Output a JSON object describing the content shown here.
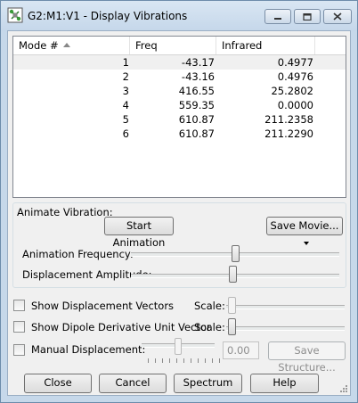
{
  "window": {
    "title": "G2:M1:V1 - Display Vibrations",
    "app_icon": "gaussview-app-icon",
    "controls": [
      "minimize-icon",
      "maximize-icon",
      "close-icon"
    ]
  },
  "table": {
    "columns": [
      "Mode #",
      "Freq",
      "Infrared"
    ],
    "sort_column": "Mode #",
    "sort_direction": "ascending",
    "selected_row": 0,
    "rows": [
      {
        "mode": "1",
        "freq": "-43.17",
        "ir": "0.4977"
      },
      {
        "mode": "2",
        "freq": "-43.16",
        "ir": "0.4976"
      },
      {
        "mode": "3",
        "freq": "416.55",
        "ir": "25.2802"
      },
      {
        "mode": "4",
        "freq": "559.35",
        "ir": "0.0000"
      },
      {
        "mode": "5",
        "freq": "610.87",
        "ir": "211.2358"
      },
      {
        "mode": "6",
        "freq": "610.87",
        "ir": "211.2290"
      }
    ]
  },
  "animate": {
    "group_label": "Animate Vibration:",
    "start_label": "Start Animation",
    "save_movie_label": "Save Movie...",
    "frequency_label": "Animation Frequency:",
    "frequency_value": 0.5,
    "amplitude_label": "Displacement Amplitude:",
    "amplitude_value": 0.49
  },
  "options": {
    "show_vectors_label": "Show Displacement Vectors",
    "show_vectors_checked": false,
    "show_dipole_label": "Show Dipole Derivative Unit Vector",
    "show_dipole_checked": false,
    "scale_label": "Scale:",
    "vectors_scale_value": 0.02,
    "dipole_scale_value": 0.02,
    "manual_label": "Manual Displacement:",
    "manual_checked": false,
    "manual_slider_value": 0.5,
    "manual_value": "0.00",
    "save_structure_label": "Save Structure..."
  },
  "footer": {
    "close_label": "Close",
    "cancel_label": "Cancel",
    "spectrum_label": "Spectrum",
    "help_label": "Help"
  }
}
